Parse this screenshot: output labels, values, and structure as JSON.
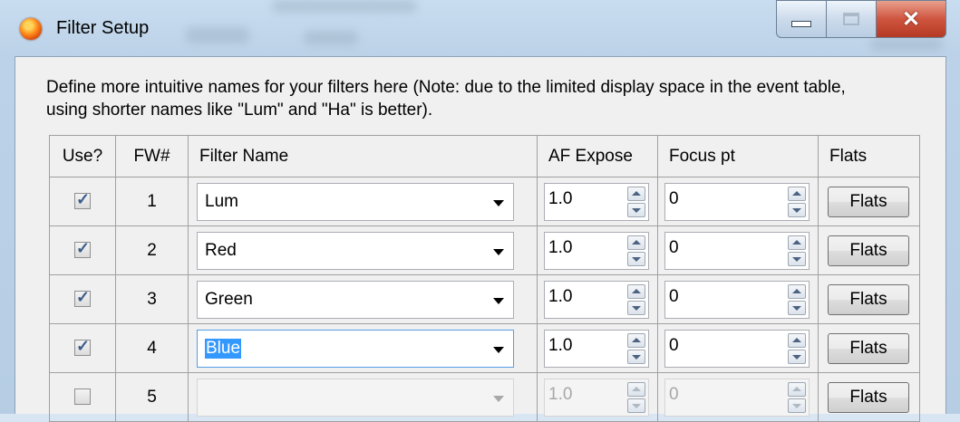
{
  "window": {
    "title": "Filter Setup"
  },
  "description": "Define more intuitive names for your filters here (Note: due to the limited display space in the event table, using shorter names like \"Lum\" and \"Ha\" is better).",
  "columns": {
    "use": "Use?",
    "fw": "FW#",
    "name": "Filter Name",
    "af_expose": "AF Expose",
    "focus_pt": "Focus pt",
    "flats": "Flats"
  },
  "rows": [
    {
      "use": true,
      "fw": "1",
      "name": "Lum",
      "af_expose": "1.0",
      "focus_pt": "0",
      "flats_label": "Flats",
      "enabled": true
    },
    {
      "use": true,
      "fw": "2",
      "name": "Red",
      "af_expose": "1.0",
      "focus_pt": "0",
      "flats_label": "Flats",
      "enabled": true
    },
    {
      "use": true,
      "fw": "3",
      "name": "Green",
      "af_expose": "1.0",
      "focus_pt": "0",
      "flats_label": "Flats",
      "enabled": true
    },
    {
      "use": true,
      "fw": "4",
      "name": "Blue",
      "af_expose": "1.0",
      "focus_pt": "0",
      "flats_label": "Flats",
      "enabled": true,
      "selected": true
    },
    {
      "use": false,
      "fw": "5",
      "name": "",
      "af_expose": "1.0",
      "focus_pt": "0",
      "flats_label": "Flats",
      "enabled": false
    }
  ],
  "icons": {
    "app": "filter-setup-app-icon",
    "minimize": "minimize-icon",
    "maximize": "maximize-icon",
    "close": "close-icon",
    "dropdown": "chevron-down-icon",
    "spin_up": "spin-up-icon",
    "spin_down": "spin-down-icon"
  },
  "colors": {
    "selection": "#3399ff",
    "close_button": "#cf553f"
  }
}
